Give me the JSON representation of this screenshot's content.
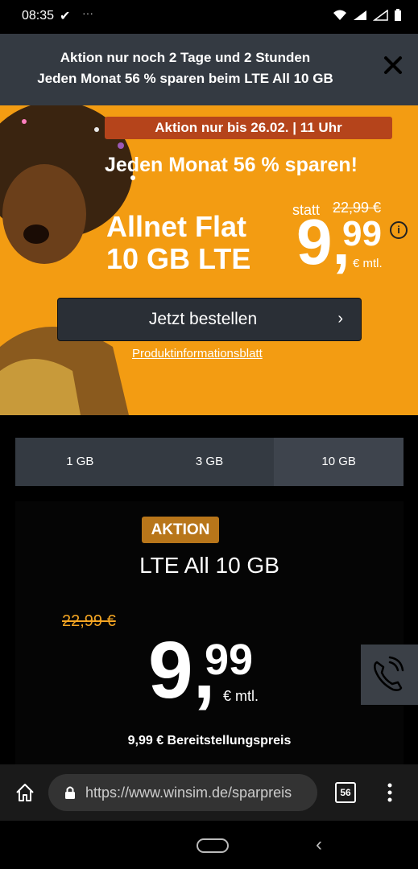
{
  "status_bar": {
    "time": "08:35",
    "check_icon": "checkmark-icon",
    "overflow": "···"
  },
  "promo_banner": {
    "line1": "Aktion nur noch 2 Tage und 2 Stunden",
    "line2": "Jeden Monat 56 % sparen beim LTE All 10 GB",
    "close_icon": "close-icon"
  },
  "hero": {
    "badge": "Aktion nur bis 26.02. | 11 Uhr",
    "headline": "Jeden Monat 56 % sparen!",
    "product_line1": "Allnet Flat",
    "product_line2": "10 GB LTE",
    "statt": "statt",
    "old_price": "22,99 €",
    "price_int": "9,",
    "price_dec": "99",
    "price_unit": "€ mtl.",
    "info": "i",
    "order_button": "Jetzt bestellen",
    "order_chevron": "›",
    "info_link": "Produktinformationsblatt",
    "accent_color": "#f39c12"
  },
  "tabs": [
    {
      "label": "1 GB",
      "active": false
    },
    {
      "label": "3 GB",
      "active": false
    },
    {
      "label": "10 GB",
      "active": true
    }
  ],
  "card": {
    "badge": "AKTION",
    "title": "LTE All 10 GB",
    "old_price": "22,99 €",
    "price_int": "9,",
    "price_dec": "99",
    "price_unit": "€ mtl.",
    "setup_fee": "9,99 € Bereitstellungspreis"
  },
  "browser": {
    "url": "https://www.winsim.de/sparpreis",
    "tab_count": "56"
  }
}
